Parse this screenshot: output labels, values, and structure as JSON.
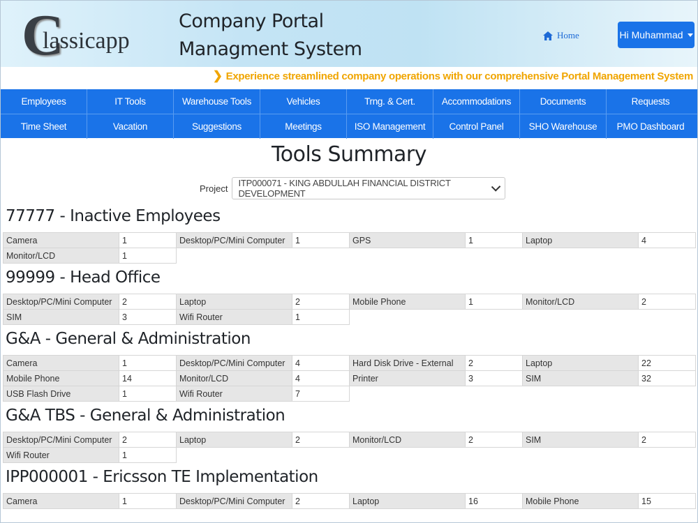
{
  "header": {
    "logo_c": "C",
    "logo_rest": "lassicapp",
    "title_line1": "Company Portal",
    "title_line2": "Managment System",
    "home_label": "Home",
    "user_label": "Hi Muhammad"
  },
  "tagline": "Experience streamlined company operations with our comprehensive Portal Management System",
  "nav": {
    "row1": [
      "Employees",
      "IT Tools",
      "Warehouse Tools",
      "Vehicles",
      "Trng. & Cert.",
      "Accommodations",
      "Documents",
      "Requests"
    ],
    "row2": [
      "Time Sheet",
      "Vacation",
      "Suggestions",
      "Meetings",
      "ISO Management",
      "Control Panel",
      "SHO Warehouse",
      "PMO Dashboard"
    ]
  },
  "page": {
    "title": "Tools Summary",
    "project_label": "Project",
    "project_value": "ITP000071 - KING ABDULLAH FINANCIAL DISTRICT DEVELOPMENT"
  },
  "sections": [
    {
      "title": "77777 - Inactive Employees",
      "rows": [
        [
          [
            "Camera",
            "1"
          ],
          [
            "Desktop/PC/Mini Computer",
            "1"
          ],
          [
            "GPS",
            "1"
          ],
          [
            "Laptop",
            "4"
          ]
        ],
        [
          [
            "Monitor/LCD",
            "1"
          ]
        ]
      ]
    },
    {
      "title": "99999 - Head Office",
      "rows": [
        [
          [
            "Desktop/PC/Mini Computer",
            "2"
          ],
          [
            "Laptop",
            "2"
          ],
          [
            "Mobile Phone",
            "1"
          ],
          [
            "Monitor/LCD",
            "2"
          ]
        ],
        [
          [
            "SIM",
            "3"
          ],
          [
            "Wifi Router",
            "1"
          ]
        ]
      ]
    },
    {
      "title": "G&A - General & Administration",
      "rows": [
        [
          [
            "Camera",
            "1"
          ],
          [
            "Desktop/PC/Mini Computer",
            "4"
          ],
          [
            "Hard Disk Drive - External",
            "2"
          ],
          [
            "Laptop",
            "22"
          ]
        ],
        [
          [
            "Mobile Phone",
            "14"
          ],
          [
            "Monitor/LCD",
            "4"
          ],
          [
            "Printer",
            "3"
          ],
          [
            "SIM",
            "32"
          ]
        ],
        [
          [
            "USB Flash Drive",
            "1"
          ],
          [
            "Wifi Router",
            "7"
          ]
        ]
      ]
    },
    {
      "title": "G&A TBS - General & Administration",
      "rows": [
        [
          [
            "Desktop/PC/Mini Computer",
            "2"
          ],
          [
            "Laptop",
            "2"
          ],
          [
            "Monitor/LCD",
            "2"
          ],
          [
            "SIM",
            "2"
          ]
        ],
        [
          [
            "Wifi Router",
            "1"
          ]
        ]
      ]
    },
    {
      "title": "IPP000001 - Ericsson TE Implementation",
      "rows": [
        [
          [
            "Camera",
            "1"
          ],
          [
            "Desktop/PC/Mini Computer",
            "2"
          ],
          [
            "Laptop",
            "16"
          ],
          [
            "Mobile Phone",
            "15"
          ]
        ]
      ]
    }
  ]
}
